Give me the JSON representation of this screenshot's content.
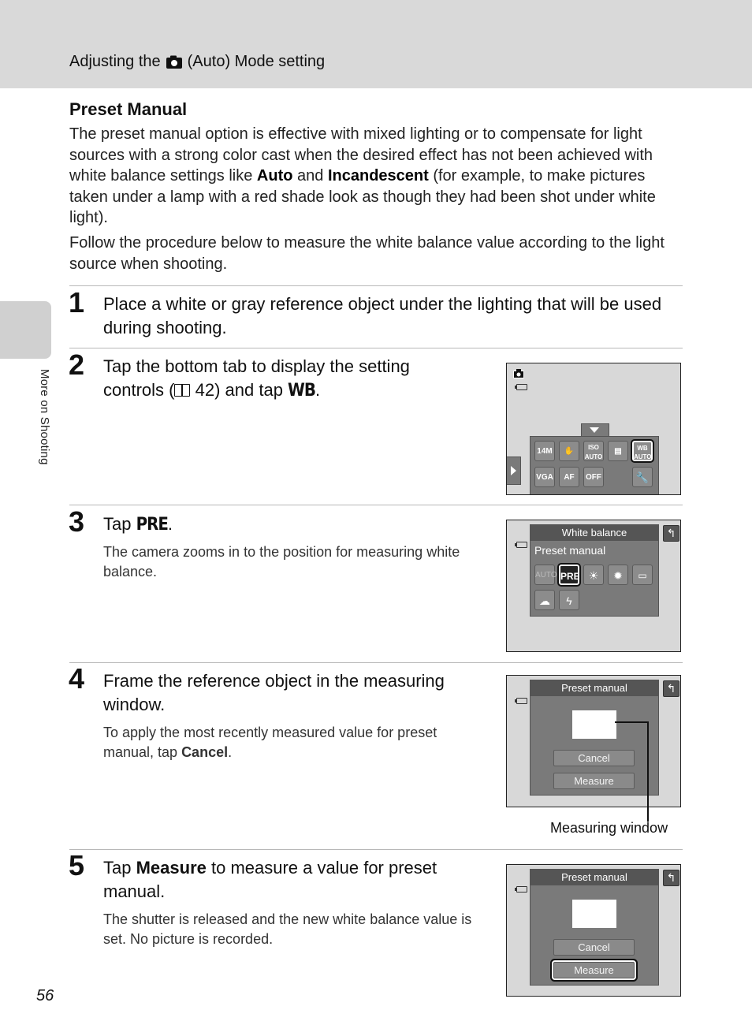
{
  "header": {
    "title_prefix": "Adjusting the",
    "title_icon": "camera-auto-icon",
    "title_suffix": "(Auto) Mode setting"
  },
  "side_tab": {
    "label": "More on Shooting"
  },
  "section": {
    "title": "Preset Manual",
    "para1": {
      "before": "The preset manual option is effective with mixed lighting or to compensate for light sources with a strong color cast when the desired effect has not been achieved with white balance settings like ",
      "bold1": "Auto",
      "middle": " and ",
      "bold2": "Incandescent",
      "after": " (for example, to make pictures taken under a lamp with a red shade look as though they had been shot under white light)."
    },
    "para2": "Follow the procedure below to measure the white balance value according to the light source when shooting."
  },
  "steps": [
    {
      "number": "1",
      "title": "Place a white or gray reference object under the lighting that will be used during shooting."
    },
    {
      "number": "2",
      "title_before": "Tap the bottom tab to display the setting controls (",
      "page_ref_icon": "book-icon",
      "page_ref": "42",
      "title_middle": ") and tap ",
      "glyph": "WB",
      "title_after": "."
    },
    {
      "number": "3",
      "title_before": "Tap ",
      "glyph": "PRE",
      "title_after": ".",
      "desc": "The camera zooms in to the position for measuring white balance."
    },
    {
      "number": "4",
      "title": "Frame the reference object in the measuring window.",
      "desc_before": "To apply the most recently measured value for preset manual, tap ",
      "desc_bold": "Cancel",
      "desc_after": "."
    },
    {
      "number": "5",
      "title_before": "Tap ",
      "title_bold": "Measure",
      "title_after": " to measure a value for preset manual.",
      "desc": "The shutter is released and the new white balance value is set. No picture is recorded."
    }
  ],
  "screens": {
    "setting_controls": {
      "row1": [
        "14M",
        "touch",
        "ISO AUTO",
        "continuous",
        "WB AUTO"
      ],
      "row2": [
        "VGA",
        "AF",
        "OFF",
        "setup"
      ],
      "selected": "WB AUTO"
    },
    "white_balance": {
      "header": "White balance",
      "current": "Preset manual",
      "options": [
        "AUTO",
        "PRE",
        "daylight",
        "incandescent",
        "fluorescent",
        "cloudy",
        "flash"
      ],
      "selected": "PRE"
    },
    "preset_manual_1": {
      "header": "Preset manual",
      "cancel": "Cancel",
      "measure": "Measure"
    },
    "preset_manual_2": {
      "header": "Preset manual",
      "cancel": "Cancel",
      "measure": "Measure",
      "selected": "Measure"
    }
  },
  "callout": {
    "label": "Measuring window"
  },
  "page_number": "56"
}
